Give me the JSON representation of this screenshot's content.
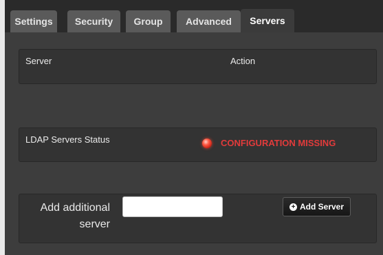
{
  "tabs": [
    {
      "label": "Settings"
    },
    {
      "label": "Security"
    },
    {
      "label": "Group"
    },
    {
      "label": "Advanced"
    },
    {
      "label": "Servers",
      "active": true
    }
  ],
  "server_table": {
    "columns": [
      "Server",
      "Action"
    ]
  },
  "ldap_status": {
    "label": "LDAP Servers Status",
    "indicator_icon": "red-led-icon",
    "status_text": "CONFIGURATION MISSING",
    "status_color": "#e23b3b"
  },
  "add_server": {
    "label_line1": "Add additional",
    "label_line2": "server",
    "input_value": "",
    "button_label": "Add Server",
    "button_icon": "plus-circle-icon"
  }
}
